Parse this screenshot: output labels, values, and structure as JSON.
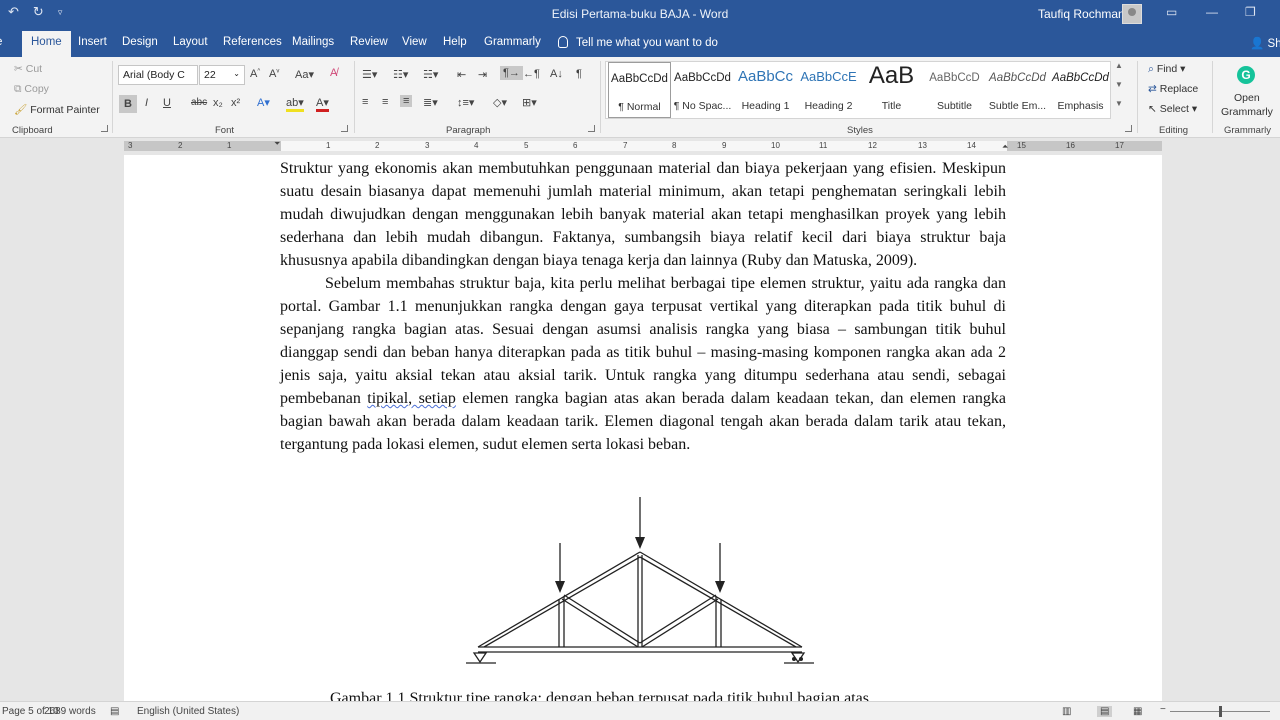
{
  "titlebar": {
    "doc_title": "Edisi Pertama-buku BAJA  -  Word",
    "user": "Taufiq Rochman"
  },
  "tabs": [
    {
      "label": "Home"
    },
    {
      "label": "Insert"
    },
    {
      "label": "Design"
    },
    {
      "label": "Layout"
    },
    {
      "label": "References"
    },
    {
      "label": "Mailings"
    },
    {
      "label": "Review"
    },
    {
      "label": "View"
    },
    {
      "label": "Help"
    },
    {
      "label": "Grammarly"
    }
  ],
  "tell_me": "Tell me what you want to do",
  "share_label": "Sha",
  "clipboard": {
    "cut": "Cut",
    "copy": "Copy",
    "format_painter": "Format Painter",
    "group_label": "Clipboard"
  },
  "font": {
    "name": "Arial (Body C",
    "size": "22",
    "group_label": "Font",
    "bold": "B",
    "italic": "I",
    "underline": "U"
  },
  "paragraph": {
    "group_label": "Paragraph"
  },
  "styles": {
    "group_label": "Styles",
    "items": [
      {
        "preview": "AaBbCcDd",
        "name": "¶ Normal"
      },
      {
        "preview": "AaBbCcDd",
        "name": "¶ No Spac..."
      },
      {
        "preview": "AaBbCc",
        "name": "Heading 1"
      },
      {
        "preview": "AaBbCcE",
        "name": "Heading 2"
      },
      {
        "preview": "AaB",
        "name": "Title"
      },
      {
        "preview": "AaBbCcD",
        "name": "Subtitle"
      },
      {
        "preview": "AaBbCcDd",
        "name": "Subtle Em..."
      },
      {
        "preview": "AaBbCcDd",
        "name": "Emphasis"
      }
    ]
  },
  "editing": {
    "find": "Find",
    "replace": "Replace",
    "select": "Select",
    "group_label": "Editing"
  },
  "grammarly": {
    "open_line1": "Open",
    "open_line2": "Grammarly",
    "group_label": "Grammarly"
  },
  "ruler_numbers": [
    "3",
    "2",
    "1",
    "1",
    "2",
    "3",
    "4",
    "5",
    "6",
    "7",
    "8",
    "9",
    "10",
    "11",
    "12",
    "13",
    "14",
    "15",
    "16",
    "17"
  ],
  "document": {
    "paragraph1": "Struktur yang ekonomis akan membutuhkan penggunaan material dan biaya pekerjaan yang efisien. Meskipun suatu desain biasanya dapat memenuhi jumlah material minimum, akan tetapi penghematan seringkali lebih mudah diwujudkan dengan menggunakan lebih banyak material akan tetapi menghasilkan proyek yang lebih sederhana dan lebih mudah dibangun. Faktanya, sumbangsih biaya relatif kecil dari biaya struktur baja khususnya apabila dibandingkan dengan biaya tenaga kerja dan lainnya (Ruby dan Matuska, 2009).",
    "paragraph2_a": "Sebelum membahas struktur baja, kita perlu melihat berbagai tipe elemen struktur, yaitu ada rangka dan portal. Gambar 1.1 menunjukkan rangka dengan gaya terpusat vertikal yang diterapkan pada titik buhul di sepanjang rangka bagian atas. Sesuai dengan asumsi analisis rangka yang biasa – sambungan titik buhul dianggap sendi dan beban hanya diterapkan pada as titik buhul – masing-masing komponen rangka akan ada 2 jenis saja, yaitu aksial tekan atau aksial tarik. Untuk rangka yang ditumpu sederhana atau sendi, sebagai pembebanan ",
    "paragraph2_flag": "tipikal,  setiap",
    "paragraph2_b": " elemen rangka bagian atas akan berada dalam keadaan tekan, dan elemen rangka bagian bawah akan berada dalam keadaan tarik. Elemen diagonal tengah akan berada dalam tarik atau tekan, tergantung pada lokasi elemen, sudut elemen serta lokasi beban.",
    "caption": "Gambar 1.1 Struktur tipe rangka: dengan beban terpusat pada titik buhul bagian atas"
  },
  "status": {
    "page": "5 of 10",
    "words": "2689 words",
    "language": "English (United States)"
  },
  "colors": {
    "brand": "#2b579a",
    "ribbon_bg": "#f3f3f3",
    "grammarly": "#15c39a"
  }
}
